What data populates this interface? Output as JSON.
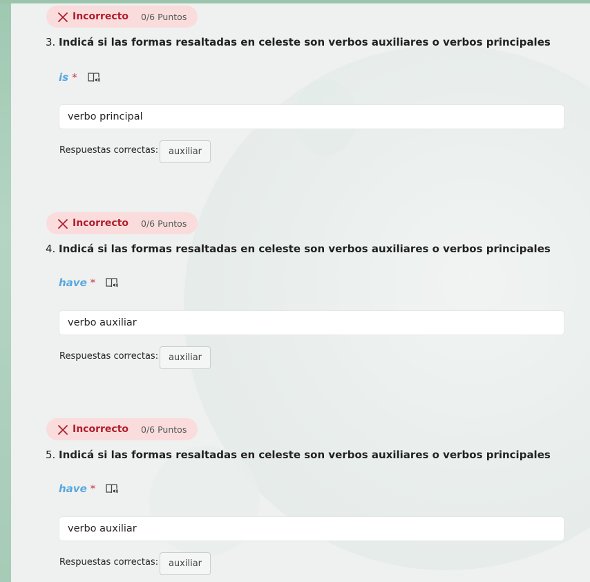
{
  "colors": {
    "incorrect_text": "#b01d2b",
    "incorrect_bg": "#fbdcdd",
    "highlight_blue": "#58a6df",
    "required_red": "#c4314b"
  },
  "questions": [
    {
      "status": "Incorrecto",
      "points": "0/6 Puntos",
      "number": "3.",
      "text": "Indicá si las formas resaltadas en celeste son verbos auxiliares o verbos principales",
      "prompt_word": "is",
      "required_mark": "*",
      "answer": "verbo principal",
      "correct_label": "Respuestas correctas:",
      "correct_answer": "auxiliar",
      "icons": [
        "close-x-icon",
        "immersive-reader-icon"
      ]
    },
    {
      "status": "Incorrecto",
      "points": "0/6 Puntos",
      "number": "4.",
      "text": "Indicá si las formas resaltadas en celeste son verbos auxiliares o verbos principales",
      "prompt_word": "have",
      "required_mark": "*",
      "answer": "verbo auxiliar",
      "correct_label": "Respuestas correctas:",
      "correct_answer": "auxiliar",
      "icons": [
        "close-x-icon",
        "immersive-reader-icon"
      ]
    },
    {
      "status": "Incorrecto",
      "points": "0/6 Puntos",
      "number": "5.",
      "text": "Indicá si las formas resaltadas en celeste son verbos auxiliares o verbos principales",
      "prompt_word": "have",
      "required_mark": "*",
      "answer": "verbo auxiliar",
      "correct_label": "Respuestas correctas:",
      "correct_answer": "auxiliar",
      "icons": [
        "close-x-icon",
        "immersive-reader-icon"
      ]
    }
  ]
}
